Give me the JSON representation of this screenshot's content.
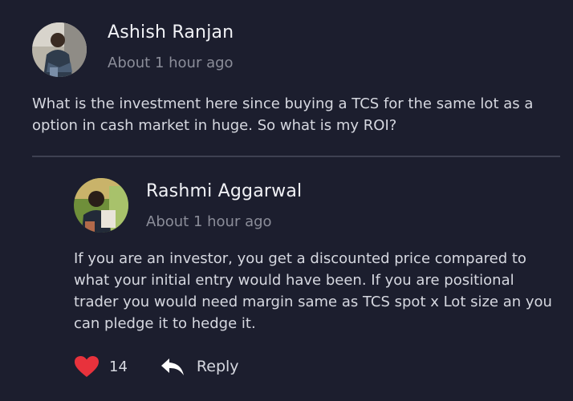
{
  "comment": {
    "author": "Ashish Ranjan",
    "time": "About 1 hour ago",
    "text": "What is the investment here since buying a TCS for the same lot as a option in cash market in huge. So what is my ROI?"
  },
  "reply": {
    "author": "Rashmi Aggarwal",
    "time": "About 1 hour ago",
    "text": "If you are an investor, you get a discounted price compared to what your initial entry would have been. If you are positional trader you would need margin same as TCS spot x Lot size an you can pledge it to hedge it.",
    "likes": "14",
    "reply_label": "Reply"
  },
  "icons": {
    "like": "heart-icon",
    "reply": "reply-arrow-icon"
  },
  "colors": {
    "background": "#1c1e2e",
    "like": "#e8323c",
    "muted": "#8b8d99",
    "divider": "#3e4152"
  }
}
